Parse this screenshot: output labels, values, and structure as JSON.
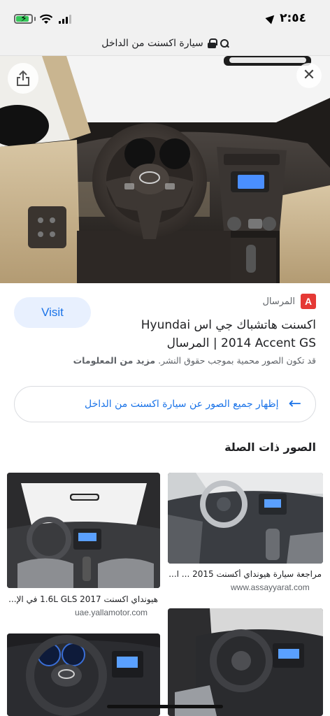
{
  "status_bar": {
    "time": "٢:٥٤",
    "battery_level": 0.85
  },
  "url_bar": {
    "query": "سيارة اكسنت من الداخل"
  },
  "hero": {
    "share_icon": "share-icon",
    "close_icon": "close-icon",
    "close_label": "✕"
  },
  "result": {
    "source_name": "المرسال",
    "source_logo_letter": "A",
    "visit_label": "Visit",
    "title": "اكسنت هاتشباك جي اس Hyundai 2014 Accent GS | المرسال",
    "copyright_notice": "قد تكون الصور محمية بموجب حقوق النشر.",
    "learn_more": "مزيد من المعلومات"
  },
  "all_images": {
    "label": "إظهار جميع الصور عن سيارة اكسنت من الداخل",
    "arrow": "←"
  },
  "related": {
    "heading": "الصور ذات الصلة",
    "items": [
      {
        "title": "مراجعة سيارة هيونداي أكسنت 2015 ... ا...",
        "source": "www.assayyarat.com"
      },
      {
        "title": "هيونداي اكسنت 1.6L GLS 2017 في الإ...",
        "source": "uae.yallamotor.com"
      }
    ]
  }
}
